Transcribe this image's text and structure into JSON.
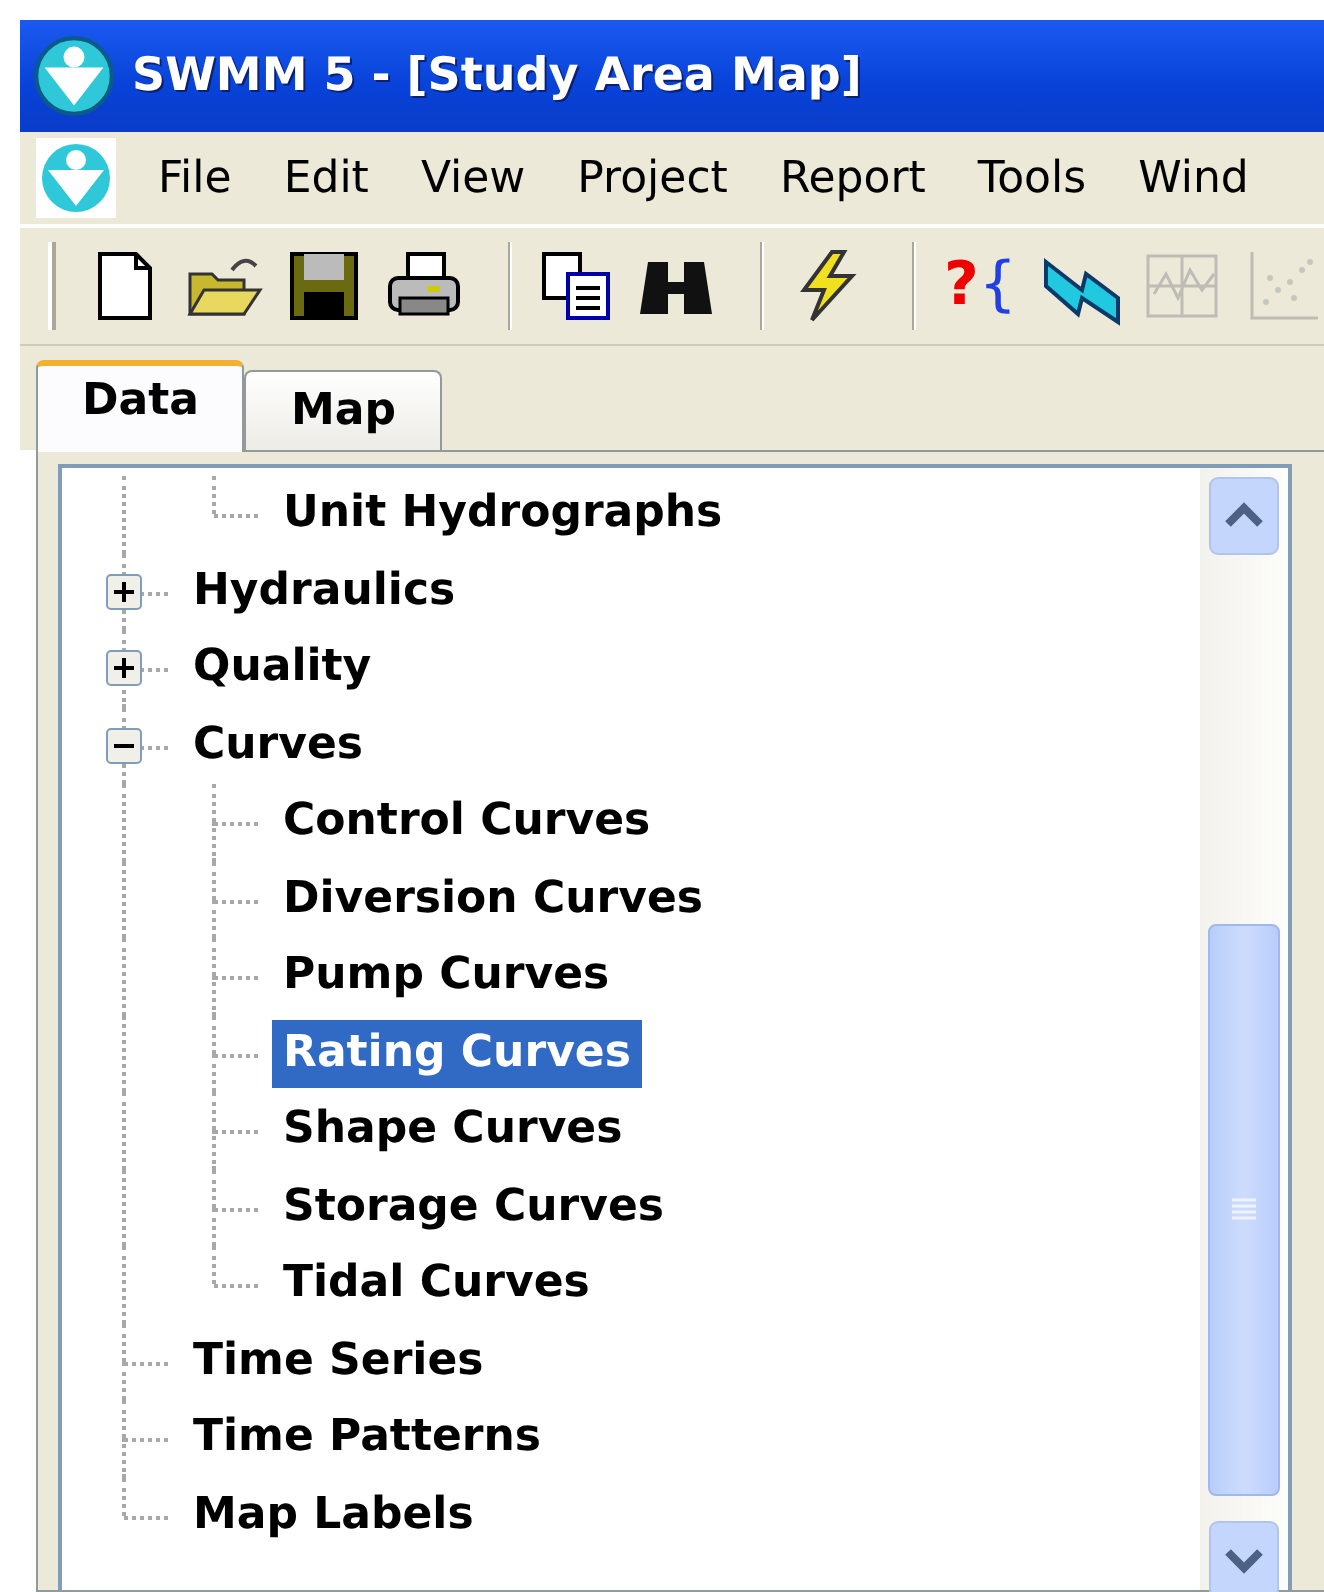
{
  "window": {
    "title": "SWMM 5 - [Study Area Map]"
  },
  "menu": [
    "File",
    "Edit",
    "View",
    "Project",
    "Report",
    "Tools",
    "Wind"
  ],
  "toolbar": [
    {
      "kind": "new",
      "disabled": false
    },
    {
      "kind": "open",
      "disabled": false
    },
    {
      "kind": "save",
      "disabled": false
    },
    {
      "kind": "print",
      "disabled": false
    },
    {
      "kind": "separator"
    },
    {
      "kind": "copy",
      "disabled": false
    },
    {
      "kind": "find",
      "disabled": false
    },
    {
      "kind": "separator"
    },
    {
      "kind": "run",
      "disabled": false
    },
    {
      "kind": "separator"
    },
    {
      "kind": "query",
      "mark": "?",
      "bracket": "{",
      "disabled": false
    },
    {
      "kind": "profile",
      "disabled": false
    },
    {
      "kind": "timeseries",
      "disabled": true
    },
    {
      "kind": "scatter",
      "disabled": true
    }
  ],
  "tabs": [
    {
      "label": "Data",
      "selected": true
    },
    {
      "label": "Map",
      "selected": false
    }
  ],
  "tree": {
    "items": [
      {
        "children": [
          {
            "label": "Unit Hydrographs",
            "selected": false
          }
        ]
      },
      {
        "label": "Hydraulics",
        "expanded": false,
        "selected": false
      },
      {
        "label": "Quality",
        "expanded": false,
        "selected": false
      },
      {
        "label": "Curves",
        "expanded": true,
        "selected": false,
        "children": [
          {
            "label": "Control Curves",
            "selected": false
          },
          {
            "label": "Diversion Curves",
            "selected": false
          },
          {
            "label": "Pump Curves",
            "selected": false
          },
          {
            "label": "Rating Curves",
            "selected": true
          },
          {
            "label": "Shape Curves",
            "selected": false
          },
          {
            "label": "Storage Curves",
            "selected": false
          },
          {
            "label": "Tidal Curves",
            "selected": false
          }
        ]
      },
      {
        "label": "Time Series",
        "selected": false
      },
      {
        "label": "Time Patterns",
        "selected": false
      },
      {
        "label": "Map Labels",
        "selected": false
      }
    ]
  }
}
